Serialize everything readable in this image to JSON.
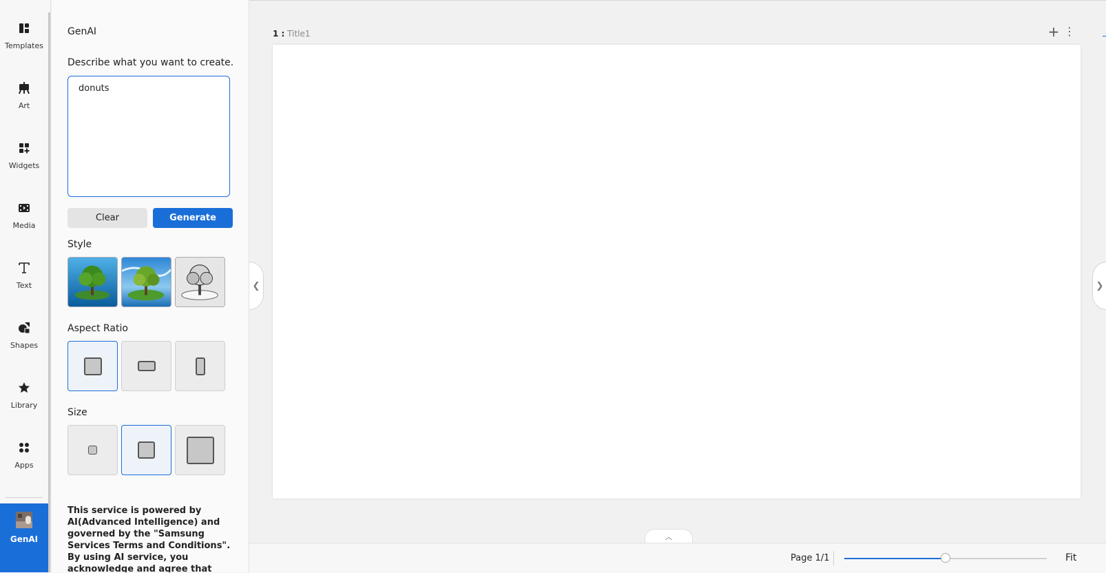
{
  "rail": {
    "items": [
      {
        "label": "Templates",
        "icon": "templates-icon"
      },
      {
        "label": "Art",
        "icon": "easel-icon"
      },
      {
        "label": "Widgets",
        "icon": "widgets-icon"
      },
      {
        "label": "Media",
        "icon": "film-icon"
      },
      {
        "label": "Text",
        "icon": "text-t-icon"
      },
      {
        "label": "Shapes",
        "icon": "shapes-icon"
      },
      {
        "label": "Library",
        "icon": "star-icon"
      },
      {
        "label": "Apps",
        "icon": "apps-grid-icon"
      },
      {
        "label": "GenAI",
        "icon": "genai-icon",
        "active": true
      }
    ]
  },
  "panel": {
    "title": "GenAI",
    "prompt_label": "Describe what you want to create.",
    "prompt_value": "donuts",
    "clear_label": "Clear",
    "generate_label": "Generate",
    "style_label": "Style",
    "aspect_label": "Aspect Ratio",
    "size_label": "Size",
    "selected_aspect": "square",
    "selected_size": "medium",
    "disclaimer": "This service is powered by AI(Advanced Intelligence) and governed by the \"Samsung Services Terms and Conditions\". By using AI service, you acknowledge and agree that generated content may be"
  },
  "canvas": {
    "page_number": "1 :",
    "page_title": "Title1",
    "add_icon": "plus-icon",
    "more_icon": "more-vertical-icon"
  },
  "status": {
    "page_count": "Page 1/1",
    "zoom_fraction": 0.5,
    "fit_label": "Fit"
  },
  "colors": {
    "accent": "#1a6ed8"
  }
}
